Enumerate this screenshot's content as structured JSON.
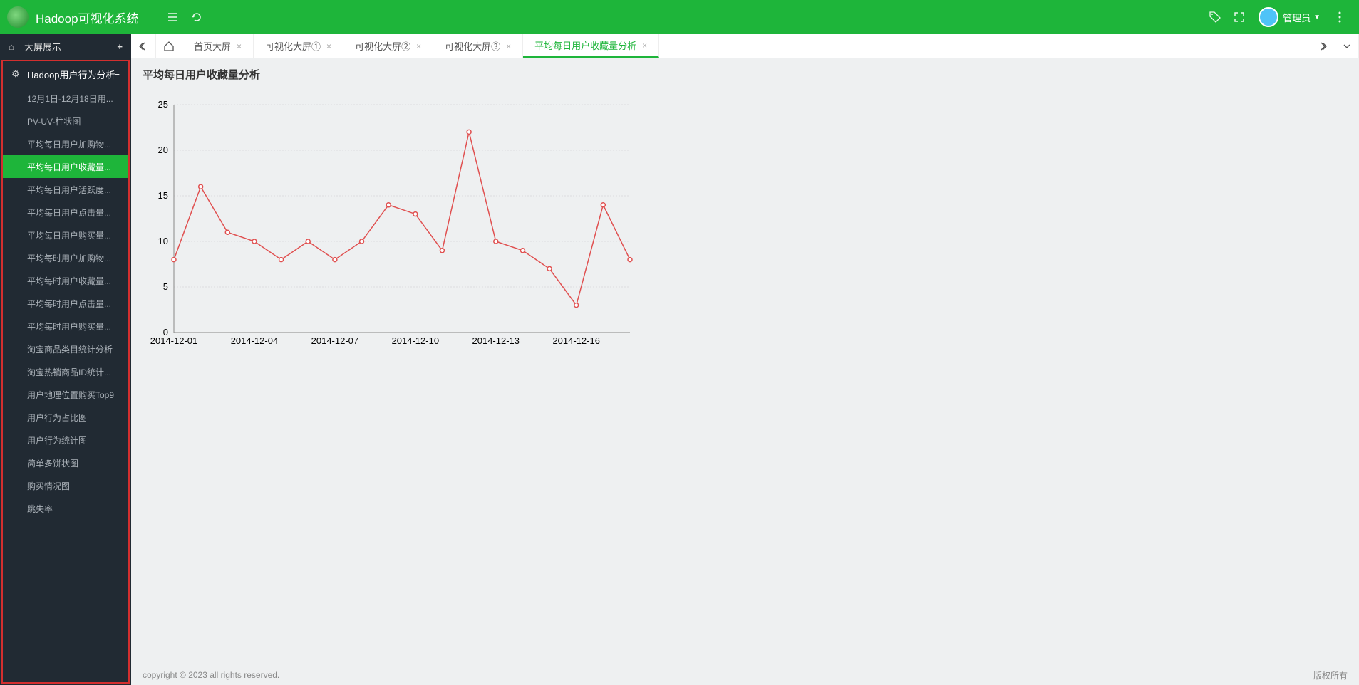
{
  "header": {
    "title": "Hadoop可视化系统",
    "user_label": "管理员"
  },
  "sidebar": {
    "group1": {
      "label": "大屏展示"
    },
    "section1": {
      "label": "Hadoop用户行为分析"
    },
    "items": [
      {
        "label": "12月1日-12月18日用..."
      },
      {
        "label": "PV-UV-柱状图"
      },
      {
        "label": "平均每日用户加购物..."
      },
      {
        "label": "平均每日用户收藏量..."
      },
      {
        "label": "平均每日用户活跃度..."
      },
      {
        "label": "平均每日用户点击量..."
      },
      {
        "label": "平均每日用户购买量..."
      },
      {
        "label": "平均每时用户加购物..."
      },
      {
        "label": "平均每时用户收藏量..."
      },
      {
        "label": "平均每时用户点击量..."
      },
      {
        "label": "平均每时用户购买量..."
      },
      {
        "label": "淘宝商品类目统计分析"
      },
      {
        "label": "淘宝热销商品ID统计..."
      },
      {
        "label": "用户地理位置购买Top9"
      },
      {
        "label": "用户行为占比图"
      },
      {
        "label": "用户行为统计图"
      },
      {
        "label": "简单多饼状图"
      },
      {
        "label": "购买情况图"
      },
      {
        "label": "跳失率"
      }
    ],
    "active_index": 3
  },
  "tabs": {
    "items": [
      {
        "label": "首页大屏"
      },
      {
        "label": "可视化大屏①"
      },
      {
        "label": "可视化大屏②"
      },
      {
        "label": "可视化大屏③"
      },
      {
        "label": "平均每日用户收藏量分析"
      }
    ],
    "active_index": 4
  },
  "content": {
    "title": "平均每日用户收藏量分析"
  },
  "chart_data": {
    "type": "line",
    "title": "",
    "xlabel": "",
    "ylabel": "",
    "ylim": [
      0,
      25
    ],
    "yticks": [
      0,
      5,
      10,
      15,
      20,
      25
    ],
    "categories": [
      "2014-12-01",
      "2014-12-02",
      "2014-12-03",
      "2014-12-04",
      "2014-12-05",
      "2014-12-06",
      "2014-12-07",
      "2014-12-08",
      "2014-12-09",
      "2014-12-10",
      "2014-12-11",
      "2014-12-12",
      "2014-12-13",
      "2014-12-14",
      "2014-12-15",
      "2014-12-16",
      "2014-12-17",
      "2014-12-18"
    ],
    "xtick_labels": [
      "2014-12-01",
      "2014-12-04",
      "2014-12-07",
      "2014-12-10",
      "2014-12-13",
      "2014-12-16"
    ],
    "xtick_indices": [
      0,
      3,
      6,
      9,
      12,
      15
    ],
    "values": [
      8,
      16,
      11,
      10,
      8,
      10,
      8,
      10,
      14,
      13,
      9,
      22,
      10,
      9,
      7,
      3,
      14,
      8
    ]
  },
  "footer": {
    "left": "copyright © 2023 all rights reserved.",
    "right": "版权所有"
  }
}
